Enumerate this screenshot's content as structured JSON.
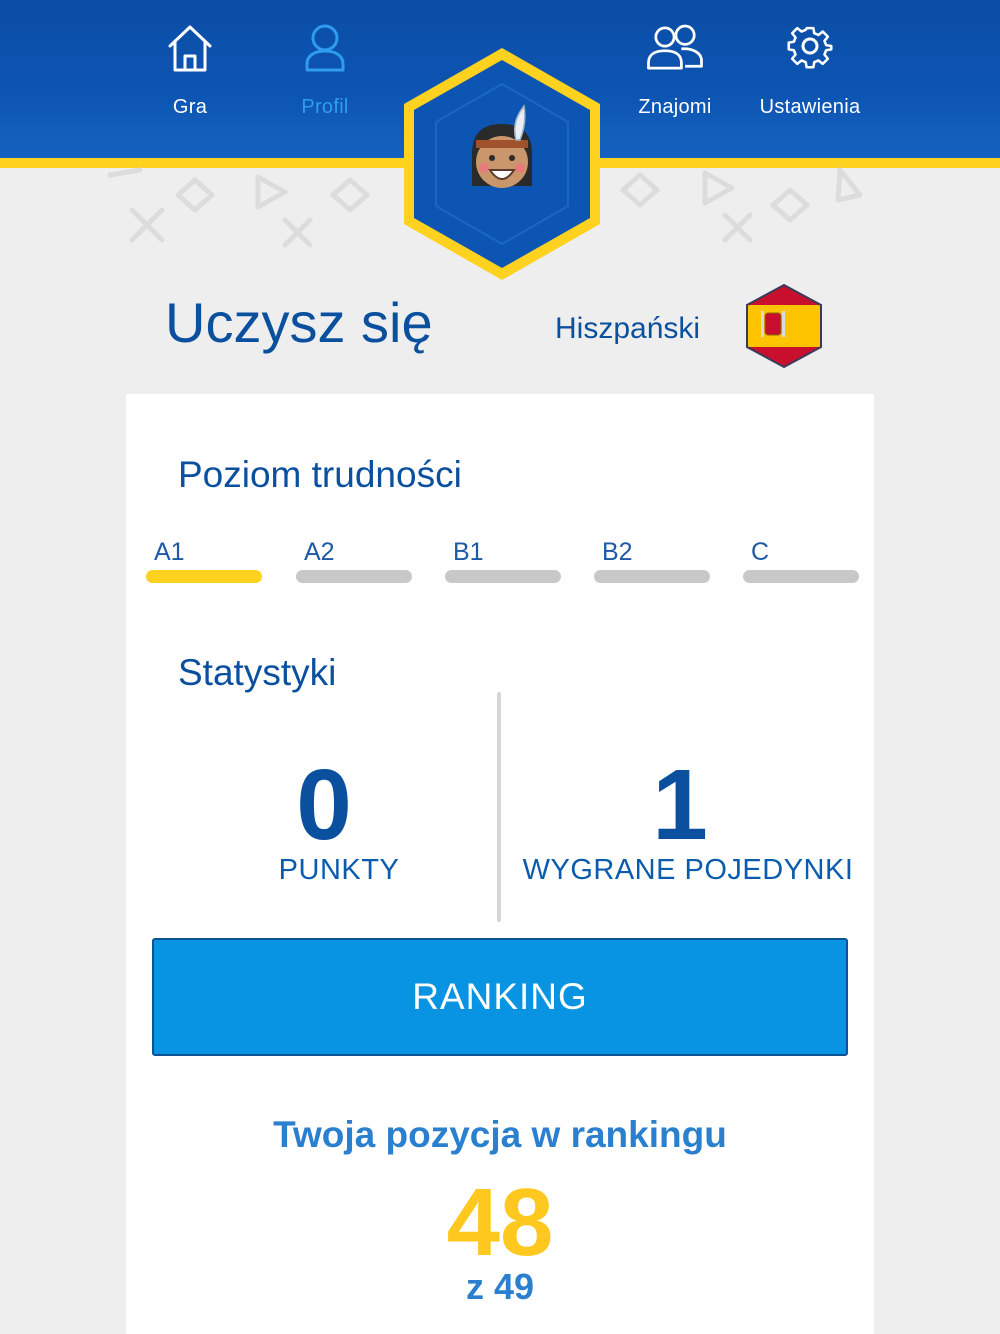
{
  "nav": {
    "items": [
      {
        "label": "Gra",
        "icon": "home-icon",
        "active": false
      },
      {
        "label": "Profil",
        "icon": "user-icon",
        "active": true
      },
      {
        "label": "Znajomi",
        "icon": "friends-icon",
        "active": false
      },
      {
        "label": "Ustawienia",
        "icon": "gear-icon",
        "active": false
      }
    ]
  },
  "colors": {
    "header_blue": "#0d55b3",
    "accent_yellow": "#ffd21f",
    "text_blue": "#0b4f9f",
    "button_blue": "#0894e2",
    "active_nav": "#2f9cf0"
  },
  "learning": {
    "title": "Uczysz się",
    "language": "Hiszpański",
    "flag_icon": "spain-flag-icon"
  },
  "difficulty": {
    "title": "Poziom trudności",
    "levels": [
      "A1",
      "A2",
      "B1",
      "B2",
      "C"
    ],
    "selected": "A1"
  },
  "stats": {
    "title": "Statystyki",
    "points_value": "0",
    "points_label": "PUNKTY",
    "duels_value": "1",
    "duels_label": "WYGRANE POJEDYNKI"
  },
  "ranking": {
    "button_label": "RANKING",
    "position_title": "Twoja pozycja w rankingu",
    "position": "48",
    "of_total": "z 49"
  }
}
